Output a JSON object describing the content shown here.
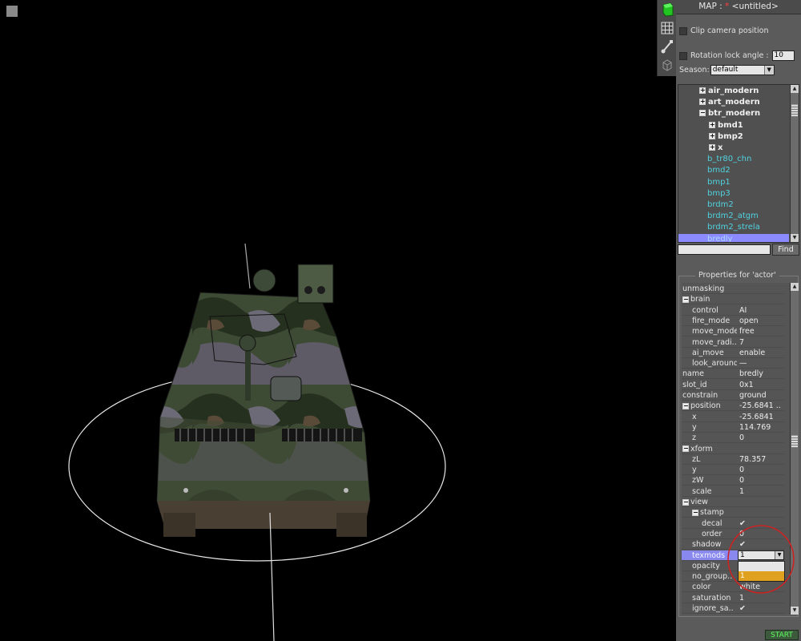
{
  "window": {
    "map_prefix": "MAP : ",
    "modified_mark": "*",
    "map_name": "<untitled>"
  },
  "options": {
    "clip_camera_label": "Clip camera position",
    "clip_camera_checked": false,
    "rotation_lock_label": "Rotation lock angle :",
    "rotation_lock_checked": false,
    "rotation_lock_value": "10",
    "season_label": "Season:",
    "season_value": "default"
  },
  "toolbar": {
    "icons": [
      "green-cube-icon",
      "grid-icon",
      "brush-icon",
      "wireframe-cube-icon"
    ]
  },
  "tree": {
    "items": [
      {
        "label": "air_modern",
        "expander": "+",
        "bold": true
      },
      {
        "label": "art_modern",
        "expander": "+",
        "bold": true
      },
      {
        "label": "btr_modern",
        "expander": "−",
        "bold": true
      },
      {
        "label": "bmd1",
        "expander": "+",
        "bold": true
      },
      {
        "label": "bmp2",
        "expander": "+",
        "bold": true
      },
      {
        "label": "x",
        "expander": "+",
        "bold": true
      },
      {
        "label": "b_tr80_chn",
        "expander": "",
        "bold": false
      },
      {
        "label": "bmd2",
        "expander": "",
        "bold": false
      },
      {
        "label": "bmp1",
        "expander": "",
        "bold": false
      },
      {
        "label": "bmp3",
        "expander": "",
        "bold": false
      },
      {
        "label": "brdm2",
        "expander": "",
        "bold": false
      },
      {
        "label": "brdm2_atgm",
        "expander": "",
        "bold": false
      },
      {
        "label": "brdm2_strela",
        "expander": "",
        "bold": false
      },
      {
        "label": "bredly",
        "expander": "",
        "bold": false,
        "selected": true
      }
    ]
  },
  "find": {
    "input_value": "",
    "button_label": "Find"
  },
  "properties": {
    "title": "Properties for 'actor'",
    "rows": [
      {
        "key": "unmasking",
        "value": "",
        "expander": "",
        "level": 0
      },
      {
        "key": "brain",
        "value": "",
        "expander": "−",
        "level": 0
      },
      {
        "key": "control",
        "value": "AI",
        "expander": "",
        "level": 1
      },
      {
        "key": "fire_mode",
        "value": "open",
        "expander": "",
        "level": 1
      },
      {
        "key": "move_mode",
        "value": "free",
        "expander": "",
        "level": 1
      },
      {
        "key": "move_radi..",
        "value": "7",
        "expander": "",
        "level": 1
      },
      {
        "key": "ai_move",
        "value": "enable",
        "expander": "",
        "level": 1
      },
      {
        "key": "look_around",
        "value": "—",
        "expander": "",
        "level": 1
      },
      {
        "key": "name",
        "value": "bredly",
        "expander": "",
        "level": 0
      },
      {
        "key": "slot_id",
        "value": "0x1",
        "expander": "",
        "level": 0
      },
      {
        "key": "constrain",
        "value": "ground",
        "expander": "",
        "level": 0
      },
      {
        "key": "position",
        "value": "-25.6841 ..",
        "expander": "−",
        "level": 0
      },
      {
        "key": "x",
        "value": "-25.6841",
        "expander": "",
        "level": 1
      },
      {
        "key": "y",
        "value": "114.769",
        "expander": "",
        "level": 1
      },
      {
        "key": "z",
        "value": "0",
        "expander": "",
        "level": 1
      },
      {
        "key": "xform",
        "value": "",
        "expander": "−",
        "level": 0
      },
      {
        "key": "zL",
        "value": "78.357",
        "expander": "",
        "level": 1
      },
      {
        "key": "y",
        "value": "0",
        "expander": "",
        "level": 1
      },
      {
        "key": "zW",
        "value": "0",
        "expander": "",
        "level": 1
      },
      {
        "key": "scale",
        "value": "1",
        "expander": "",
        "level": 1
      },
      {
        "key": "view",
        "value": "",
        "expander": "−",
        "level": 0
      },
      {
        "key": "stamp",
        "value": "",
        "expander": "−",
        "level": 1
      },
      {
        "key": "decal",
        "value": "✔",
        "expander": "",
        "level": 2
      },
      {
        "key": "order",
        "value": "0",
        "expander": "",
        "level": 2
      },
      {
        "key": "shadow",
        "value": "✔",
        "expander": "",
        "level": 1
      },
      {
        "key": "texmods",
        "value": "1",
        "expander": "",
        "level": 1,
        "selected": true,
        "dropdown": true
      },
      {
        "key": "opacity",
        "value": "",
        "expander": "",
        "level": 1
      },
      {
        "key": "no_group..",
        "value": "",
        "expander": "",
        "level": 1
      },
      {
        "key": "color",
        "value": "white",
        "expander": "",
        "level": 1
      },
      {
        "key": "saturation",
        "value": "1",
        "expander": "",
        "level": 1
      },
      {
        "key": "ignore_sa..",
        "value": "✔",
        "expander": "",
        "level": 1
      }
    ],
    "dropdown_options": [
      "",
      "1"
    ],
    "dropdown_selected_index": 1
  },
  "status": {
    "start_label": "START"
  },
  "colors": {
    "tree_leaf": "#4fd3e0",
    "selection": "#8b8bff",
    "dropdown_highlight": "#e0a020",
    "annotation_circle": "#d02020",
    "start_text": "#5cff5c"
  }
}
